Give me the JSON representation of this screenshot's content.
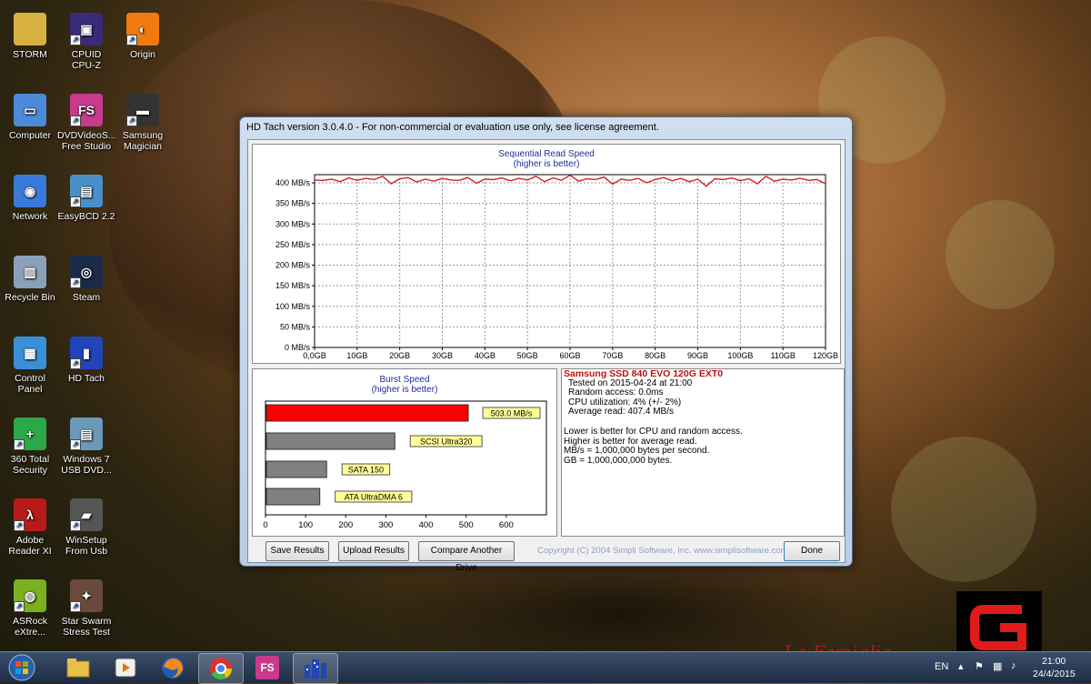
{
  "desktop_icons": [
    {
      "label": "STORM"
    },
    {
      "label": "CPUID\nCPU-Z"
    },
    {
      "label": "Origin"
    },
    {
      "label": "Computer"
    },
    {
      "label": "DVDVideoS...\nFree Studio"
    },
    {
      "label": "Samsung\nMagician"
    },
    {
      "label": "Network"
    },
    {
      "label": "EasyBCD 2.2"
    },
    {
      "label": "Recycle Bin"
    },
    {
      "label": "Steam"
    },
    {
      "label": "Control\nPanel"
    },
    {
      "label": "HD Tach"
    },
    {
      "label": "360 Total\nSecurity"
    },
    {
      "label": "Windows 7\nUSB DVD..."
    },
    {
      "label": "Adobe\nReader XI"
    },
    {
      "label": "WinSetup\nFrom Usb"
    },
    {
      "label": "ASRock\neXtre..."
    },
    {
      "label": "Star Swarm\nStress Test"
    }
  ],
  "window": {
    "title": "HD Tach version 3.0.4.0  - For non-commercial or evaluation use only, see license agreement."
  },
  "sequential_chart": {
    "title": "Sequential Read Speed",
    "subtitle": "(higher is better)"
  },
  "burst_chart": {
    "title": "Burst Speed",
    "subtitle": "(higher is better)"
  },
  "info": {
    "drive": "Samsung SSD 840 EVO 120G EXT0",
    "tested": "Tested on 2015-04-24 at 21:00",
    "random_access": "Random access: 0.0ms",
    "cpu": "CPU utilization: 4% (+/- 2%)",
    "avg_read": "Average read: 407.4 MB/s",
    "note1": "Lower is better for CPU and random access.",
    "note2": "Higher is better for average read.",
    "note3": "MB/s = 1,000,000 bytes per second.",
    "note4": "GB = 1,000,000,000 bytes."
  },
  "buttons": {
    "save": "Save Results",
    "upload": "Upload Results",
    "compare": "Compare Another Drive",
    "done": "Done"
  },
  "copyright": "Copyright (C) 2004 Simpli Software, Inc. www.simplisoftware.com",
  "tray": {
    "lang": "EN",
    "time": "21:00",
    "date": "24/4/2015"
  },
  "watermark": "La Famiglia",
  "colors": {
    "line": "#d42020",
    "burst_bar": "#ff0000",
    "other_bar": "#808080",
    "label_bg": "#ffff99"
  },
  "chart_data": [
    {
      "type": "line",
      "title": "Sequential Read Speed",
      "subtitle": "(higher is better)",
      "xlabel": "",
      "ylabel": "",
      "x_ticks": [
        "0,0GB",
        "10GB",
        "20GB",
        "30GB",
        "40GB",
        "50GB",
        "60GB",
        "70GB",
        "80GB",
        "90GB",
        "100GB",
        "110GB",
        "120GB"
      ],
      "y_ticks": [
        "0 MB/s",
        "50 MB/s",
        "100 MB/s",
        "150 MB/s",
        "200 MB/s",
        "250 MB/s",
        "300 MB/s",
        "350 MB/s",
        "400 MB/s"
      ],
      "xlim": [
        0,
        120
      ],
      "ylim": [
        0,
        420
      ],
      "grid": true,
      "series": [
        {
          "x": [
            0,
            2,
            4,
            6,
            8,
            10,
            12,
            14,
            16,
            18,
            20,
            22,
            24,
            26,
            28,
            30,
            32,
            34,
            36,
            38,
            40,
            42,
            44,
            46,
            48,
            50,
            52,
            54,
            56,
            58,
            60,
            62,
            64,
            66,
            68,
            70,
            72,
            74,
            76,
            78,
            80,
            82,
            84,
            86,
            88,
            90,
            92,
            94,
            96,
            98,
            100,
            102,
            104,
            106,
            108,
            110,
            112,
            114,
            116,
            118,
            120
          ],
          "values": [
            407,
            406,
            409,
            403,
            412,
            406,
            411,
            408,
            416,
            398,
            410,
            413,
            402,
            409,
            404,
            411,
            407,
            406,
            413,
            399,
            409,
            408,
            412,
            405,
            411,
            407,
            416,
            403,
            412,
            406,
            419,
            404,
            410,
            408,
            414,
            397,
            409,
            406,
            411,
            400,
            408,
            413,
            405,
            411,
            403,
            409,
            392,
            410,
            408,
            412,
            405,
            410,
            398,
            416,
            404,
            409,
            407,
            411,
            406,
            408,
            398
          ]
        }
      ]
    },
    {
      "type": "bar",
      "orientation": "horizontal",
      "title": "Burst Speed",
      "subtitle": "(higher is better)",
      "x_ticks": [
        "0",
        "100",
        "200",
        "300",
        "400",
        "500",
        "600"
      ],
      "xlim": [
        0,
        700
      ],
      "grid": false,
      "categories": [
        "503.0 MB/s",
        "SCSI Ultra320",
        "SATA 150",
        "ATA UltraDMA 6"
      ],
      "values": [
        503,
        320,
        150,
        133
      ]
    }
  ]
}
